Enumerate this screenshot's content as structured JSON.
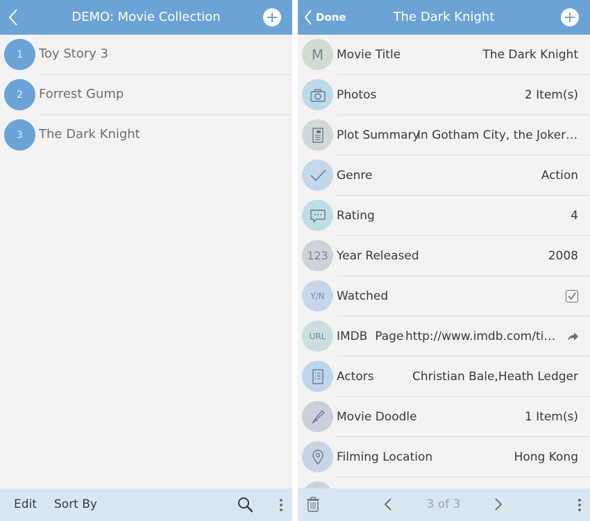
{
  "left_panel": {
    "title": "DEMO: Movie Collection",
    "movies": [
      {
        "number": "1",
        "name": "Toy Story 3"
      },
      {
        "number": "2",
        "name": "Forrest Gump"
      },
      {
        "number": "3",
        "name": "The Dark Knight"
      }
    ],
    "toolbar": {
      "edit_label": "Edit",
      "sort_label": "Sort By"
    }
  },
  "right_panel": {
    "done_label": "Done",
    "title": "The Dark Knight",
    "fields": {
      "movie_title": {
        "icon_text": "M",
        "label": "Movie Title",
        "value": "The Dark Knight"
      },
      "photos": {
        "label": "Photos",
        "value": "2 Item(s)"
      },
      "plot_summary": {
        "label": "Plot Summary",
        "value": "In Gotham City, the Joker an…"
      },
      "genre": {
        "label": "Genre",
        "value": "Action"
      },
      "rating": {
        "label": "Rating",
        "value": "4"
      },
      "year_released": {
        "icon_text": "123",
        "label": "Year Released",
        "value": "2008"
      },
      "watched": {
        "icon_text": "Y/N",
        "label": "Watched",
        "checked": true
      },
      "imdb_page": {
        "icon_text": "URL",
        "label": "IMDB  Page",
        "value": "http://www.imdb.com/title/…"
      },
      "actors": {
        "label": "Actors",
        "value": "Christian Bale,Heath Ledger"
      },
      "movie_doodle": {
        "label": "Movie Doodle",
        "value": "1 Item(s)"
      },
      "filming_location": {
        "label": "Filming Location",
        "value": "Hong Kong"
      }
    },
    "toolbar": {
      "page_indicator": "3 of 3"
    }
  },
  "colors": {
    "accent": "#6ba3d6",
    "toolbar_bg": "#d8e6f2",
    "background": "#f2f2f2"
  }
}
